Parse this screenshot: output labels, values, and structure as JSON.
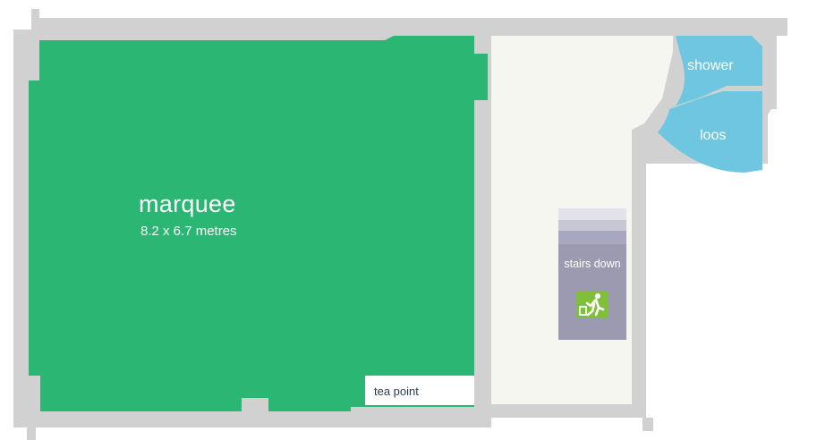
{
  "rooms": {
    "marquee": {
      "name": "marquee",
      "dimensions": "8.2 x 6.7 metres"
    },
    "shower": {
      "name": "shower"
    },
    "loos": {
      "name": "loos"
    },
    "tea_point": {
      "name": "tea point"
    },
    "stairs": {
      "name": "stairs down"
    }
  },
  "colors": {
    "marquee": "#2bb673",
    "walls": "#d0d0d0",
    "corridor": "#f6f6f0",
    "wet_rooms": "#6ec6e0",
    "stairs": "#9b9ab0",
    "exit_sign": "#7fbf3a"
  },
  "icons": {
    "exit": "emergency-exit-running-person-icon"
  }
}
